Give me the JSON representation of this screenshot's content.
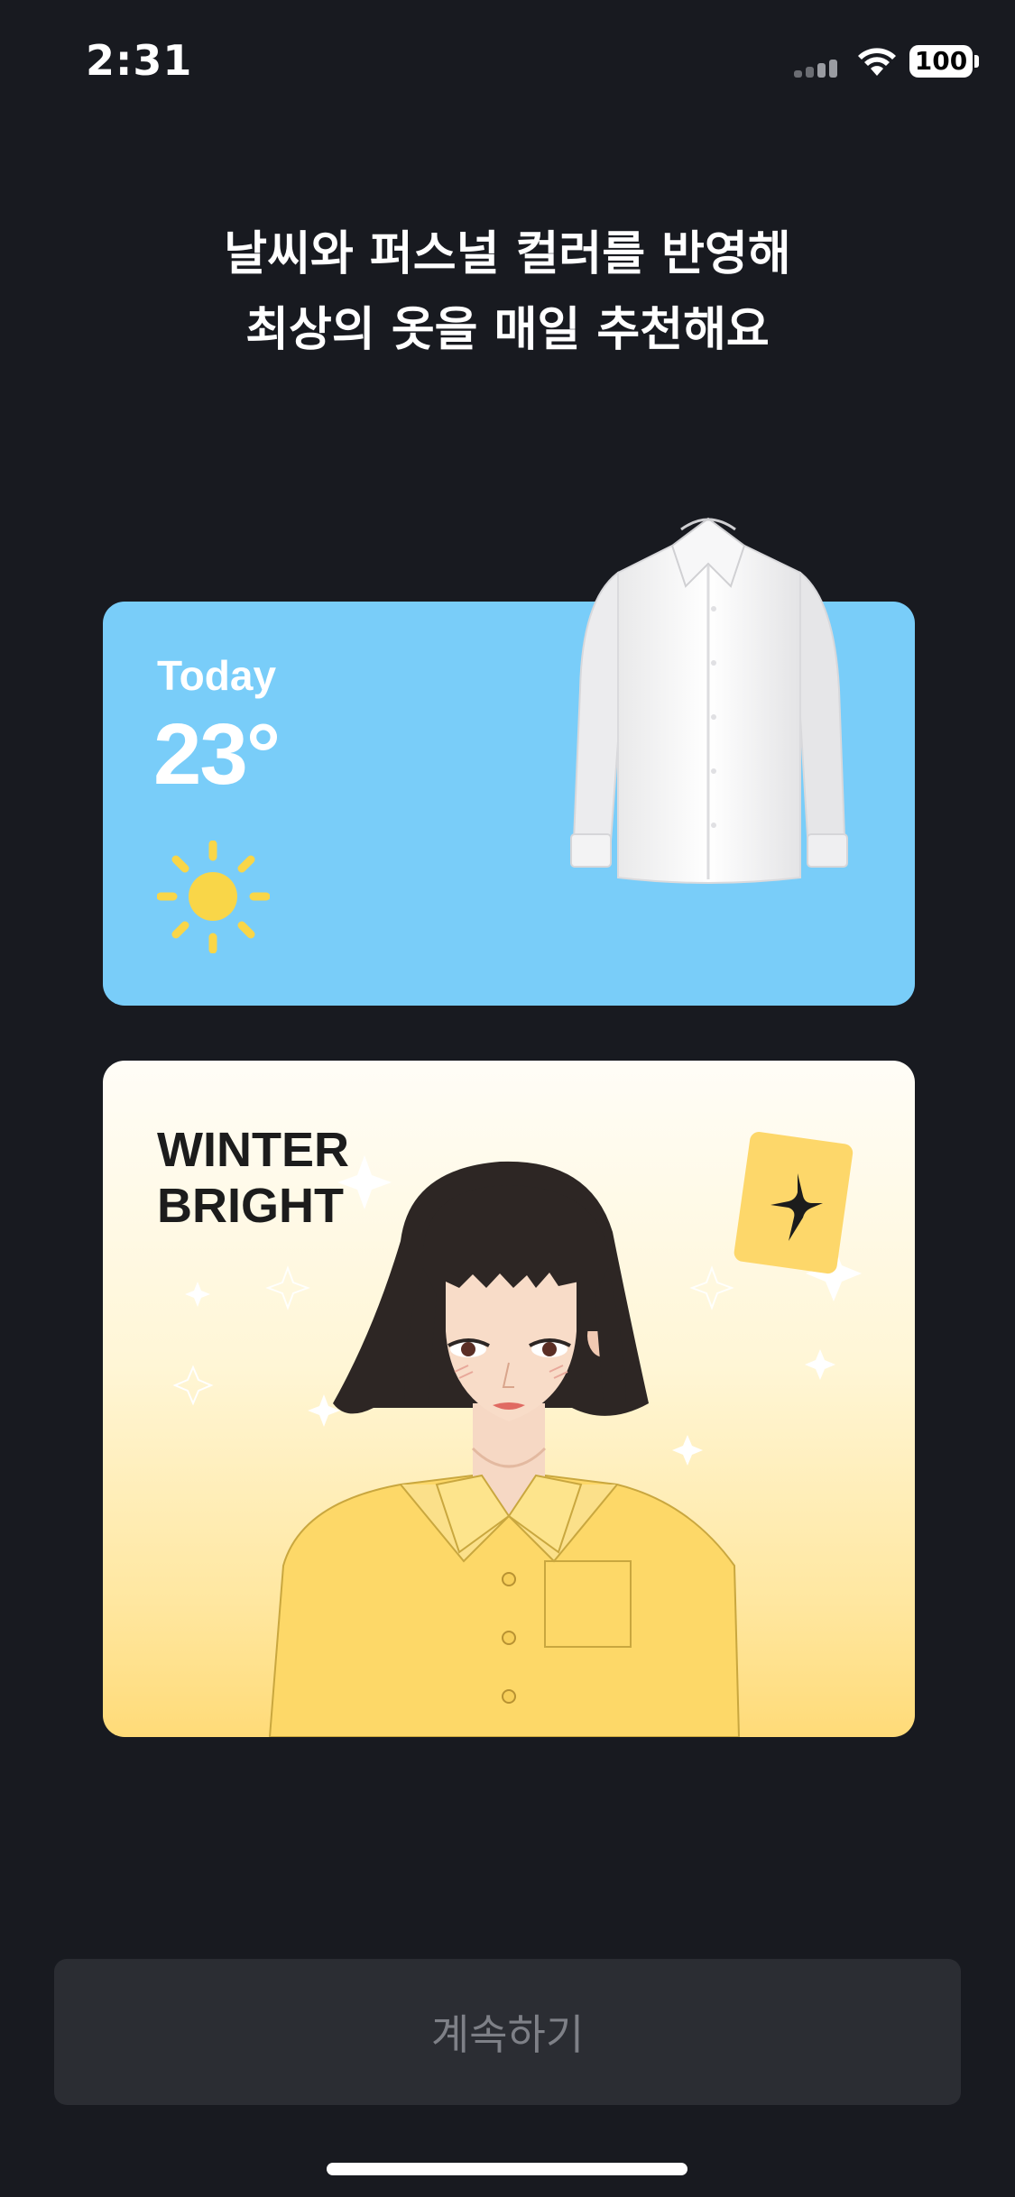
{
  "status_bar": {
    "time": "2:31",
    "battery": "100"
  },
  "headline": {
    "line1": "날씨와 퍼스널 컬러를 반영해",
    "line2": "최상의 옷을 매일 추천해요"
  },
  "weather_card": {
    "label": "Today",
    "temperature": "23°",
    "condition_icon": "sun-icon",
    "background_color": "#79cdf9",
    "clothing_icon": "white-shirt"
  },
  "personal_color_card": {
    "season_line1": "WINTER",
    "season_line2": "BRIGHT",
    "badge_icon": "sparkle-icon",
    "accent_color": "#ffdb78"
  },
  "continue_button": {
    "label": "계속하기"
  }
}
